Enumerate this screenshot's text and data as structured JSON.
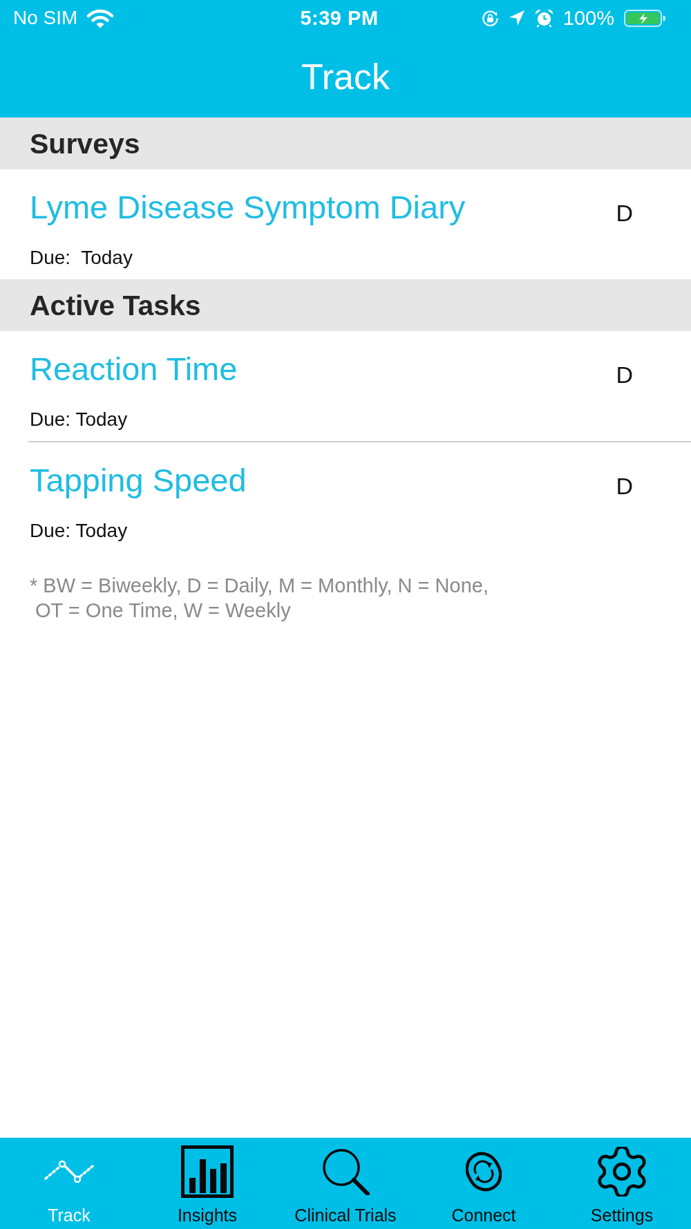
{
  "status_bar": {
    "carrier": "No SIM",
    "time": "5:39 PM",
    "battery": "100%"
  },
  "header": {
    "title": "Track"
  },
  "sections": [
    {
      "title": "Surveys",
      "items": [
        {
          "name": "Lyme Disease Symptom Diary",
          "due": "Due:  Today",
          "frequency": "D"
        }
      ]
    },
    {
      "title": "Active Tasks",
      "items": [
        {
          "name": "Reaction Time",
          "due": "Due: Today",
          "frequency": "D"
        },
        {
          "name": "Tapping Speed",
          "due": "Due: Today",
          "frequency": "D"
        }
      ]
    }
  ],
  "footnote": "* BW = Biweekly, D = Daily, M = Monthly, N = None,\n OT = One Time, W = Weekly",
  "tab_bar": {
    "tabs": [
      {
        "label": "Track",
        "selected": true
      },
      {
        "label": "Insights",
        "selected": false
      },
      {
        "label": "Clinical Trials",
        "selected": false
      },
      {
        "label": "Connect",
        "selected": false
      },
      {
        "label": "Settings",
        "selected": false
      }
    ]
  }
}
